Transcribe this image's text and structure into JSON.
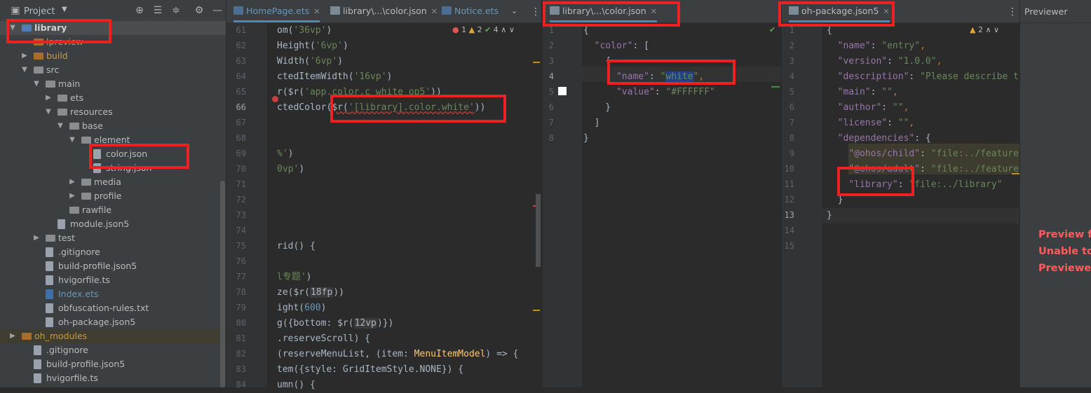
{
  "project": {
    "title": "Project",
    "tree": [
      {
        "label": "library",
        "kind": "module"
      },
      {
        "label": "lpreview",
        "kind": "folder-orange"
      },
      {
        "label": "build",
        "kind": "folder-orange"
      },
      {
        "label": "src",
        "kind": "folder"
      },
      {
        "label": "main",
        "kind": "folder"
      },
      {
        "label": "ets",
        "kind": "folder"
      },
      {
        "label": "resources",
        "kind": "folder"
      },
      {
        "label": "base",
        "kind": "folder"
      },
      {
        "label": "element",
        "kind": "folder"
      },
      {
        "label": "color.json",
        "kind": "file"
      },
      {
        "label": "string.json",
        "kind": "file"
      },
      {
        "label": "media",
        "kind": "folder"
      },
      {
        "label": "profile",
        "kind": "folder"
      },
      {
        "label": "rawfile",
        "kind": "folder"
      },
      {
        "label": "module.json5",
        "kind": "file"
      },
      {
        "label": "test",
        "kind": "folder"
      },
      {
        "label": ".gitignore",
        "kind": "file"
      },
      {
        "label": "build-profile.json5",
        "kind": "file"
      },
      {
        "label": "hvigorfile.ts",
        "kind": "file"
      },
      {
        "label": "Index.ets",
        "kind": "file"
      },
      {
        "label": "obfuscation-rules.txt",
        "kind": "file"
      },
      {
        "label": "oh-package.json5",
        "kind": "file"
      },
      {
        "label": "oh_modules",
        "kind": "folder-orange"
      },
      {
        "label": ".gitignore",
        "kind": "file"
      },
      {
        "label": "build-profile.json5",
        "kind": "file"
      },
      {
        "label": "hvigorfile.ts",
        "kind": "file"
      }
    ]
  },
  "editor1": {
    "tabs": [
      "HomePage.ets",
      "library\\...\\color.json",
      "Notice.ets"
    ],
    "inspections": {
      "errors": "1",
      "warnings": "2",
      "ok": "4"
    },
    "line_numbers": [
      "61",
      "62",
      "63",
      "64",
      "65",
      "66",
      "67",
      "68",
      "69",
      "70",
      "71",
      "72",
      "73",
      "74",
      "75",
      "76",
      "77",
      "78",
      "79",
      "80",
      "81",
      "82",
      "83",
      "84"
    ]
  },
  "editor2": {
    "tab": "library\\...\\color.json",
    "line_numbers": [
      "1",
      "2",
      "3",
      "4",
      "5",
      "6",
      "7",
      "8"
    ]
  },
  "editor3": {
    "tab": "oh-package.json5",
    "warnings": "2",
    "line_numbers": [
      "1",
      "2",
      "3",
      "4",
      "5",
      "6",
      "7",
      "8",
      "9",
      "10",
      "11",
      "12",
      "13",
      "14",
      "15"
    ]
  },
  "previewer": {
    "title": "Previewer",
    "errors": [
      "Preview fa",
      "Unable to",
      "Previewer"
    ]
  }
}
